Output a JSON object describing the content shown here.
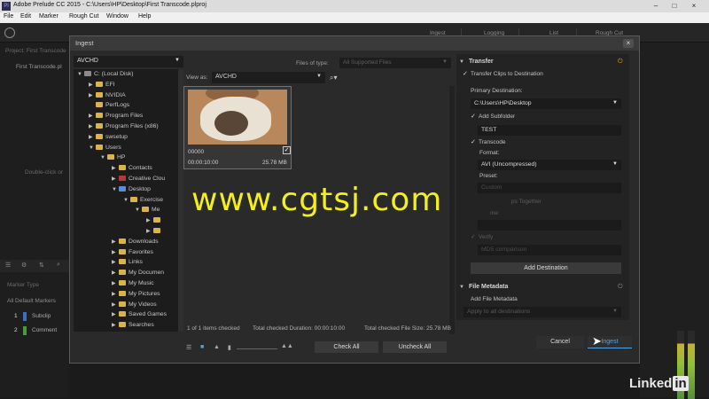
{
  "window": {
    "title": "Adobe Prelude CC 2015 - C:\\Users\\HP\\Desktop\\First Transcode.plproj",
    "app_icon": "Pl",
    "minimize": "–",
    "maximize": "□",
    "close": "×"
  },
  "menu": [
    "File",
    "Edit",
    "Marker",
    "Rough Cut",
    "Window",
    "Help"
  ],
  "workspace_tabs": [
    "Ingest",
    "Logging",
    "List",
    "Rough Cut"
  ],
  "background": {
    "project_label": "Project: First Transcode",
    "project_item": "First Transcode.pl",
    "double_click": "Double-click or",
    "marker_type": "Marker Type",
    "all_default_markers": "All Default Markers",
    "markers": [
      {
        "num": "1",
        "label": "Subclip",
        "color": "#3b6fc7"
      },
      {
        "num": "2",
        "label": "Comment",
        "color": "#4a9a3a"
      }
    ]
  },
  "dialog": {
    "title": "Ingest",
    "close": "×",
    "source": "AVCHD",
    "files_of_type_label": "Files of type:",
    "files_of_type_value": "All Supported Files",
    "view_as_label": "View as:",
    "view_as_value": "AVCHD",
    "tree": [
      {
        "label": "C: (Local Disk)",
        "level": 0,
        "arrow": "▼",
        "kind": "disk"
      },
      {
        "label": "EFI",
        "level": 1,
        "arrow": "▶",
        "kind": "folder"
      },
      {
        "label": "NVIDIA",
        "level": 1,
        "arrow": "▶",
        "kind": "folder"
      },
      {
        "label": "PerfLogs",
        "level": 1,
        "arrow": "",
        "kind": "folder"
      },
      {
        "label": "Program Files",
        "level": 1,
        "arrow": "▶",
        "kind": "folder"
      },
      {
        "label": "Program Files (x86)",
        "level": 1,
        "arrow": "▶",
        "kind": "folder"
      },
      {
        "label": "swsetup",
        "level": 1,
        "arrow": "▶",
        "kind": "folder"
      },
      {
        "label": "Users",
        "level": 1,
        "arrow": "▼",
        "kind": "folder"
      },
      {
        "label": "HP",
        "level": 2,
        "arrow": "▼",
        "kind": "folder"
      },
      {
        "label": "Contacts",
        "level": 3,
        "arrow": "▶",
        "kind": "folder"
      },
      {
        "label": "Creative Clou",
        "level": 3,
        "arrow": "▶",
        "kind": "red"
      },
      {
        "label": "Desktop",
        "level": 3,
        "arrow": "▼",
        "kind": "blue"
      },
      {
        "label": "Exercise",
        "level": 4,
        "arrow": "▼",
        "kind": "folder"
      },
      {
        "label": "Me",
        "level": 5,
        "arrow": "▼",
        "kind": "folder"
      },
      {
        "label": "",
        "level": 6,
        "arrow": "▶",
        "kind": "folder"
      },
      {
        "label": "",
        "level": 6,
        "arrow": "▶",
        "kind": "folder"
      },
      {
        "label": "Downloads",
        "level": 3,
        "arrow": "▶",
        "kind": "folder"
      },
      {
        "label": "Favorites",
        "level": 3,
        "arrow": "▶",
        "kind": "folder"
      },
      {
        "label": "Links",
        "level": 3,
        "arrow": "▶",
        "kind": "folder"
      },
      {
        "label": "My Documen",
        "level": 3,
        "arrow": "▶",
        "kind": "folder"
      },
      {
        "label": "My Music",
        "level": 3,
        "arrow": "▶",
        "kind": "folder"
      },
      {
        "label": "My Pictures",
        "level": 3,
        "arrow": "▶",
        "kind": "folder"
      },
      {
        "label": "My Videos",
        "level": 3,
        "arrow": "▶",
        "kind": "folder"
      },
      {
        "label": "Saved Games",
        "level": 3,
        "arrow": "▶",
        "kind": "folder"
      },
      {
        "label": "Searches",
        "level": 3,
        "arrow": "▶",
        "kind": "folder"
      }
    ],
    "clip": {
      "name": "00000",
      "duration": "00:00:10:00",
      "size": "25.78 MB",
      "check": "✓"
    },
    "status": {
      "checked": "1 of 1 items checked",
      "duration": "Total checked Duration: 00:00:10:00",
      "size": "Total checked File Size: 25.78 MB"
    },
    "check_all": "Check All",
    "uncheck_all": "Uncheck All",
    "transfer": {
      "header": "Transfer",
      "transfer_clips": "Transfer Clips to Destination",
      "primary_destination_label": "Primary Destination:",
      "primary_destination_value": "C:\\Users\\HP\\Desktop",
      "add_subfolder": "Add Subfolder",
      "subfolder_value": "TEST",
      "transcode": "Transcode",
      "format_label": "Format:",
      "format_value": "AVI (Uncompressed)",
      "preset_label": "Preset:",
      "preset_value": "Custom",
      "combine_label": "ps Together",
      "name_label": "me:",
      "verify": "Verify",
      "verify_value": "MD5 comparison",
      "add_destination": "Add Destination"
    },
    "file_metadata": {
      "header": "File Metadata",
      "add_file_metadata": "Add File Metadata",
      "apply_value": "Apply to all destinations"
    },
    "cancel": "Cancel",
    "ingest": "Ingest"
  },
  "watermark": "www.cgtsj.com",
  "branding": {
    "text": "Linked",
    "in": "in"
  }
}
